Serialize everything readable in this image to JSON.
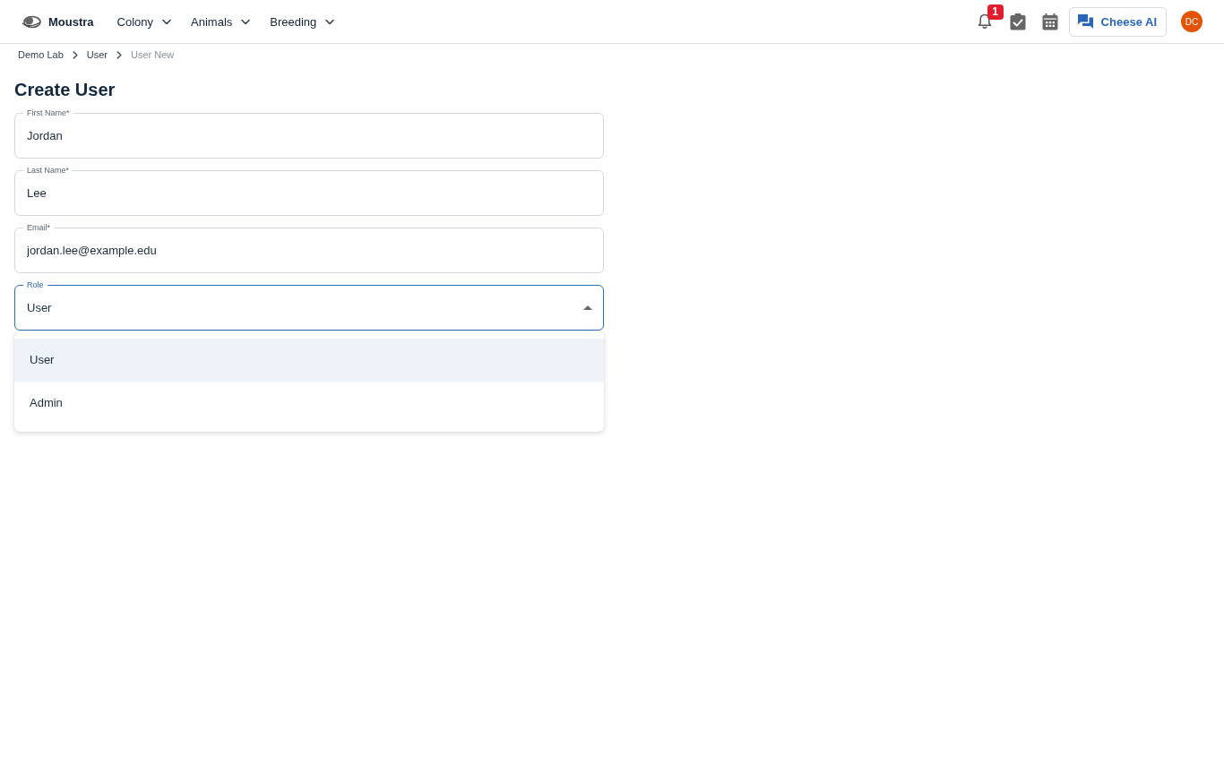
{
  "header": {
    "brand": "Moustra",
    "nav": [
      {
        "label": "Colony"
      },
      {
        "label": "Animals"
      },
      {
        "label": "Breeding"
      }
    ],
    "notification_count": "1",
    "assistant_button": "Cheese AI",
    "avatar": "DC"
  },
  "breadcrumb": [
    {
      "label": "Demo Lab",
      "current": false
    },
    {
      "label": "User",
      "current": false
    },
    {
      "label": "User New",
      "current": true
    }
  ],
  "page_title": "Create User",
  "form": {
    "fields": [
      {
        "kind": "text",
        "label": "First Name*",
        "value": "Jordan",
        "focused": false
      },
      {
        "kind": "text",
        "label": "Last Name*",
        "value": "Lee",
        "focused": false
      },
      {
        "kind": "text",
        "label": "Email*",
        "value": "jordan.lee@example.edu",
        "focused": false
      },
      {
        "kind": "select",
        "label": "Role",
        "value": "User",
        "focused": true,
        "expanded": true,
        "options": [
          {
            "label": "User",
            "selected": true
          },
          {
            "label": "Admin",
            "selected": false
          }
        ]
      }
    ]
  }
}
